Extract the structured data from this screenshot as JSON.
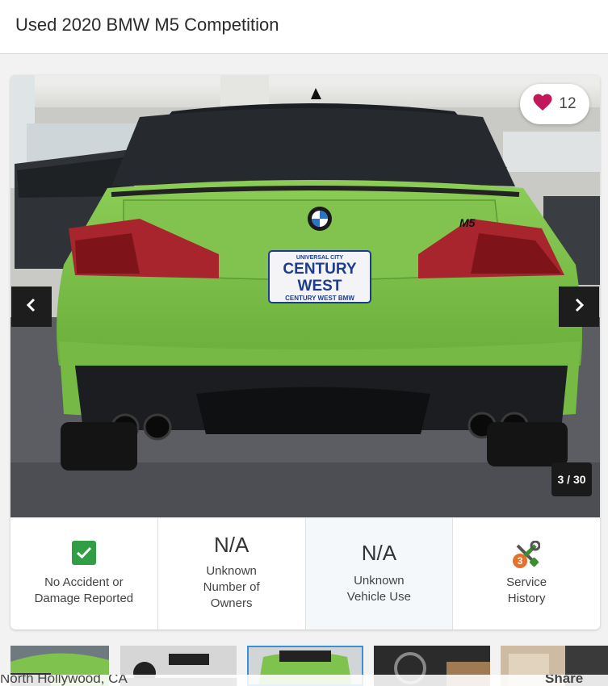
{
  "header": {
    "title": "Used 2020 BMW M5 Competition"
  },
  "gallery": {
    "favorites_count": "12",
    "counter": "3 / 30",
    "plate_top": "UNIVERSAL CITY",
    "plate_line1": "CENTURY",
    "plate_line2": "WEST",
    "plate_bottom": "CENTURY WEST BMW",
    "badge_text": "M5",
    "icons": {
      "prev": "chevron-left-icon",
      "next": "chevron-right-icon",
      "favorite": "heart-icon"
    },
    "colors": {
      "car_body": "#7cc04b",
      "heart": "#c2185b",
      "nav_bg": "#1d1d1d"
    }
  },
  "facts": [
    {
      "icon": "check-icon",
      "label": "No Accident or Damage Reported",
      "line1": "No Accident or",
      "line2": "Damage Reported"
    },
    {
      "value": "N/A",
      "label": "Unknown Number of Owners",
      "line1": "Unknown",
      "line2": "Number of",
      "line3": "Owners"
    },
    {
      "value": "N/A",
      "label": "Unknown Vehicle Use",
      "line1": "Unknown",
      "line2": "Vehicle Use"
    },
    {
      "icon": "wrench-screwdriver-icon",
      "badge": "3",
      "label": "Service History",
      "line1": "Service",
      "line2": "History"
    }
  ],
  "bottom_bar": {
    "location": "North Hollywood, CA",
    "share_label": "Share"
  },
  "colors": {
    "accent": "#3a8fd6",
    "check_green": "#2f9e44",
    "badge_orange": "#e8702a"
  }
}
